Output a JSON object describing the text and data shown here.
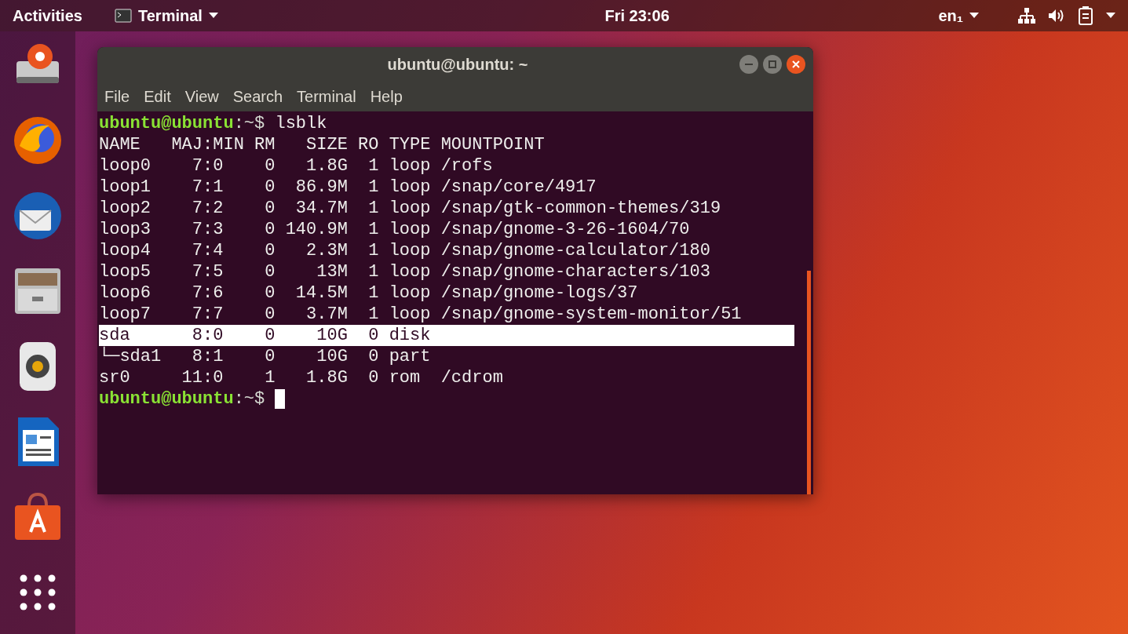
{
  "top_bar": {
    "activities": "Activities",
    "app_menu": "Terminal",
    "clock": "Fri 23:06",
    "input_source": "en₁"
  },
  "dock": {
    "items": [
      {
        "kind": "drive"
      },
      {
        "kind": "browser"
      },
      {
        "kind": "mail"
      },
      {
        "kind": "files"
      },
      {
        "kind": "speaker"
      },
      {
        "kind": "writer"
      },
      {
        "kind": "store"
      },
      {
        "kind": "grid"
      }
    ]
  },
  "window": {
    "title": "ubuntu@ubuntu: ~",
    "menu": [
      "File",
      "Edit",
      "View",
      "Search",
      "Terminal",
      "Help"
    ],
    "terminal": {
      "prompt": {
        "user_host": "ubuntu@ubuntu",
        "path": ":~$",
        "command": "lsblk"
      },
      "lines": [
        {
          "text": "NAME   MAJ:MIN RM   SIZE RO TYPE MOUNTPOINT",
          "selected": false
        },
        {
          "text": "loop0    7:0    0   1.8G  1 loop /rofs",
          "selected": false
        },
        {
          "text": "loop1    7:1    0  86.9M  1 loop /snap/core/4917",
          "selected": false
        },
        {
          "text": "loop2    7:2    0  34.7M  1 loop /snap/gtk-common-themes/319",
          "selected": false
        },
        {
          "text": "loop3    7:3    0 140.9M  1 loop /snap/gnome-3-26-1604/70",
          "selected": false
        },
        {
          "text": "loop4    7:4    0   2.3M  1 loop /snap/gnome-calculator/180",
          "selected": false
        },
        {
          "text": "loop5    7:5    0    13M  1 loop /snap/gnome-characters/103",
          "selected": false
        },
        {
          "text": "loop6    7:6    0  14.5M  1 loop /snap/gnome-logs/37",
          "selected": false
        },
        {
          "text": "loop7    7:7    0   3.7M  1 loop /snap/gnome-system-monitor/51",
          "selected": false
        },
        {
          "text": "sda      8:0    0    10G  0 disk",
          "selected": true
        },
        {
          "text": "└─sda1   8:1    0    10G  0 part",
          "selected": false
        },
        {
          "text": "sr0     11:0    1   1.8G  0 rom  /cdrom",
          "selected": false
        }
      ],
      "final_prompt": {
        "user_host": "ubuntu@ubuntu",
        "path": ":~$"
      }
    }
  }
}
